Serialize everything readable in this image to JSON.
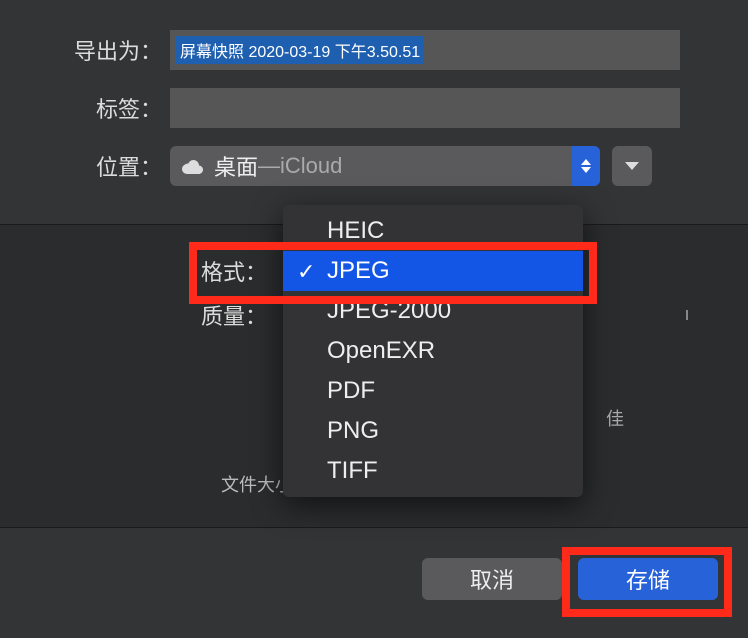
{
  "labels": {
    "export_as": "导出为：",
    "tags": "标签：",
    "location": "位置：",
    "format": "格式：",
    "quality": "质量：",
    "filesize": "文件大小："
  },
  "filename": "屏幕快照 2020-03-19 下午3.50.51",
  "location": {
    "name": "桌面",
    "separator": " — ",
    "provider": "iCloud"
  },
  "format_options": {
    "items": [
      "HEIC",
      "JPEG",
      "JPEG-2000",
      "OpenEXR",
      "PDF",
      "PNG",
      "TIFF"
    ],
    "selected": "JPEG"
  },
  "partial_char": "佳",
  "buttons": {
    "cancel": "取消",
    "save": "存储"
  }
}
